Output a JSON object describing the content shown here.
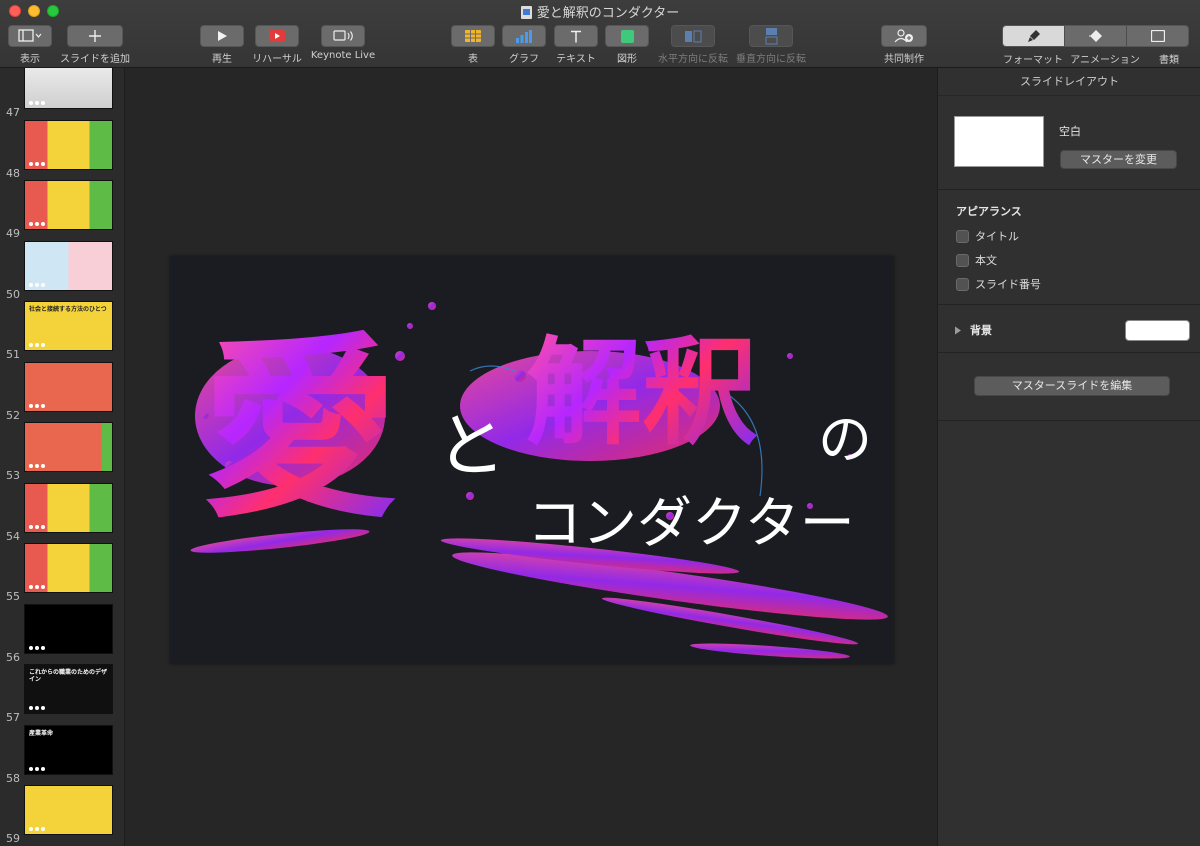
{
  "window": {
    "title": "愛と解釈のコンダクター"
  },
  "toolbar": {
    "view_label": "表示",
    "add_slide_label": "スライドを追加",
    "play_label": "再生",
    "rehearse_label": "リハーサル",
    "keynote_live_label": "Keynote Live",
    "table_label": "表",
    "chart_label": "グラフ",
    "text_label": "テキスト",
    "shape_label": "図形",
    "flip_h_label": "水平方向に反転",
    "flip_v_label": "垂直方向に反転",
    "collaborate_label": "共同制作",
    "format_label": "フォーマット",
    "animate_label": "アニメーション",
    "document_label": "書類"
  },
  "navigator": {
    "slides": [
      {
        "number": "47",
        "kind": "photo"
      },
      {
        "number": "48",
        "kind": "three-panel"
      },
      {
        "number": "49",
        "kind": "speech"
      },
      {
        "number": "50",
        "kind": "quadrant"
      },
      {
        "number": "51",
        "kind": "yellow-speech",
        "text": "社会と接続する方法のひとつ"
      },
      {
        "number": "52",
        "kind": "flow"
      },
      {
        "number": "53",
        "kind": "red"
      },
      {
        "number": "54",
        "kind": "three-panel"
      },
      {
        "number": "55",
        "kind": "speech"
      },
      {
        "number": "56",
        "kind": "black"
      },
      {
        "number": "57",
        "kind": "wordcloud",
        "text": "これからの職業のためのデザイン"
      },
      {
        "number": "58",
        "kind": "kanji-grid",
        "text": "産業革命"
      },
      {
        "number": "59",
        "kind": "yellow-flow"
      }
    ]
  },
  "slide": {
    "kanji_ai": "愛",
    "to": "と",
    "kanji_kaishaku": "解釈",
    "no": "の",
    "conductor": "コンダクター"
  },
  "inspector": {
    "header": "スライドレイアウト",
    "layout_name": "空白",
    "change_master_button": "マスターを変更",
    "appearance_title": "アピアランス",
    "checkboxes": [
      {
        "label": "タイトル",
        "checked": false
      },
      {
        "label": "本文",
        "checked": false
      },
      {
        "label": "スライド番号",
        "checked": false
      }
    ],
    "background_label": "背景",
    "background_color": "#ffffff",
    "edit_master_button": "マスタースライドを編集"
  }
}
